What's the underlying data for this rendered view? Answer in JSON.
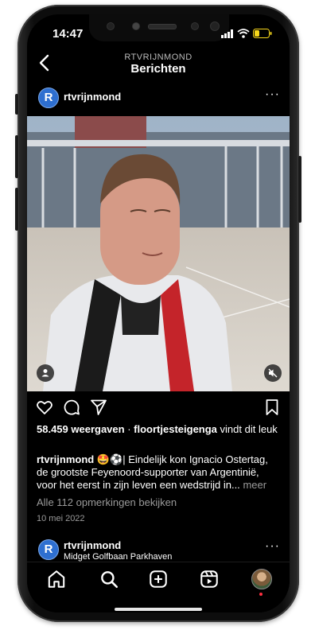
{
  "status": {
    "time": "14:47"
  },
  "header": {
    "subtitle": "RTVRIJNMOND",
    "title": "Berichten"
  },
  "post": {
    "avatar_letter": "R",
    "username": "rtvrijnmond",
    "views": "58.459 weergaven",
    "separator": "·",
    "liker": "floortjesteigenga",
    "likes_suffix": "vindt dit leuk",
    "caption_user": "rtvrijnmond",
    "caption_emoji": "🤩⚽",
    "caption_text": "| Eindelijk kon Ignacio Ostertag, de grootste Feyenoord-supporter van Argentinië, voor het eerst in zijn leven een wedstrijd in...",
    "more": "meer",
    "comments_link": "Alle 112 opmerkingen bekijken",
    "date": "10 mei 2022"
  },
  "next_post": {
    "avatar_letter": "R",
    "username": "rtvrijnmond",
    "location": "Midget Golfbaan Parkhaven"
  },
  "icons": {
    "back": "back-chevron-icon",
    "like": "heart-icon",
    "comment": "comment-icon",
    "share": "send-icon",
    "save": "bookmark-icon",
    "tag": "person-tag-icon",
    "mute": "muted-speaker-icon",
    "tabs": [
      "home-icon",
      "search-icon",
      "new-post-icon",
      "reels-icon",
      "profile-avatar"
    ]
  },
  "colors": {
    "accent": "#2e6fd0",
    "notification": "#ff3040",
    "background": "#000000"
  }
}
